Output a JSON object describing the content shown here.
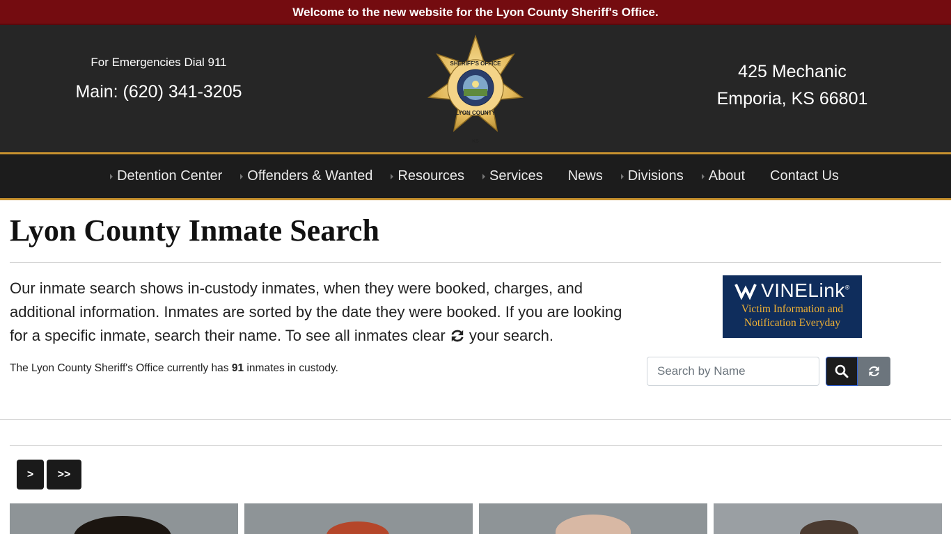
{
  "announcement": "Welcome to the new website for the Lyon County Sheriff's Office.",
  "header": {
    "emergency": "For Emergencies Dial 911",
    "main_phone": "Main: (620) 341-3205",
    "address_line1": "425 Mechanic",
    "address_line2": "Emporia, KS 66801",
    "badge": {
      "icon": "sheriff-star-badge",
      "colors": {
        "gold": "#e8c36a",
        "seal": "#2a3e6b"
      }
    }
  },
  "nav": {
    "items": [
      {
        "label": "Detention Center",
        "has_submenu": true
      },
      {
        "label": "Offenders & Wanted",
        "has_submenu": true
      },
      {
        "label": "Resources",
        "has_submenu": true
      },
      {
        "label": "Services",
        "has_submenu": true
      },
      {
        "label": "News",
        "has_submenu": false
      },
      {
        "label": "Divisions",
        "has_submenu": true
      },
      {
        "label": "About",
        "has_submenu": true
      },
      {
        "label": "Contact Us",
        "has_submenu": false
      }
    ]
  },
  "page": {
    "title": "Lyon County Inmate Search",
    "intro_part1": "Our inmate search shows in-custody inmates, when they were booked, charges, and additional information. Inmates are sorted by the date they were booked. If you are looking for a specific inmate, search their name. To see all inmates clear",
    "intro_part2": " your search.",
    "count_prefix": "The Lyon County Sheriff's Office currently has ",
    "count_value": "91",
    "count_suffix": " inmates in custody."
  },
  "vinelink": {
    "brand_a": "VINE",
    "brand_b": "Link",
    "tagline1": "Victim Information and",
    "tagline2": "Notification Everyday",
    "colors": {
      "bg": "#0f2d5c",
      "accent": "#f2b233"
    }
  },
  "search": {
    "placeholder": "Search by Name",
    "value": "",
    "search_icon": "search-icon",
    "reset_icon": "refresh-icon"
  },
  "pager": {
    "next_label": ">",
    "last_label": ">>"
  },
  "cards_count": 4,
  "colors": {
    "announce_bg": "#740c10",
    "header_bg": "#262626",
    "nav_bg": "#1c1c1c",
    "gold_border": "#c8922f"
  }
}
